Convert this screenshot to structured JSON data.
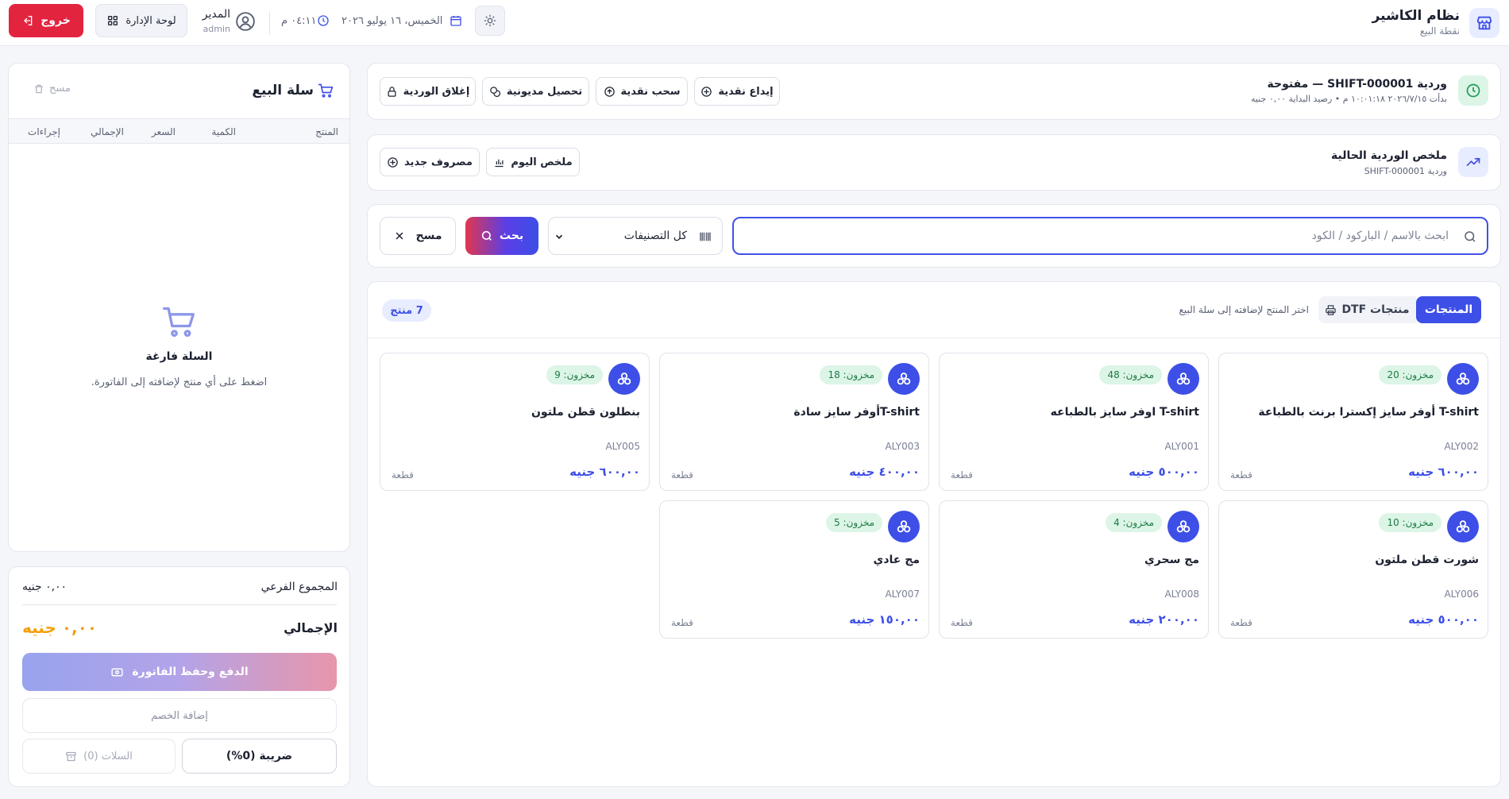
{
  "header": {
    "brand_title": "نظام الكاشير",
    "brand_subtitle": "نقطة البيع",
    "date": "الخميس، ١٦ يوليو ٢٠٢٦",
    "time": "٠٤:١١ م",
    "user_name": "المدير",
    "user_role": "admin",
    "admin_button": "لوحة الإدارة",
    "logout_button": "خروج"
  },
  "shift": {
    "title": "وردية SHIFT-000001 — مفتوحة",
    "subtitle": "بدأت ٢٠٢٦/٧/١٥ ١٠:٠١:١٨ م • رصيد البداية ٠,٠٠ جنيه",
    "actions": {
      "deposit": "إيداع نقدية",
      "withdraw": "سحب نقدية",
      "collect_debt": "تحصيل مديونية",
      "close_shift": "إغلاق الوردية"
    }
  },
  "summary": {
    "title": "ملخص الوردية الحالية",
    "subtitle": "وردية SHIFT-000001",
    "today_summary": "ملخص اليوم",
    "new_expense": "مصروف جديد"
  },
  "search": {
    "placeholder": "ابحث بالاسم / الباركود / الكود",
    "value": "",
    "category_selected": "كل التصنيفات",
    "search_button": "بحث",
    "clear_button": "مسح"
  },
  "tabs": {
    "products": "المنتجات",
    "dtf_products": "منتجات DTF",
    "hint": "اختر المنتج لإضافته إلى سلة البيع",
    "count": "7 منتج"
  },
  "products": [
    {
      "stock": "مخزون: 20",
      "name": "T-shirt أوفر سايز إكسترا برنت بالطباعة",
      "code": "ALY002",
      "price": "٦٠٠,٠٠ جنيه",
      "unit": "قطعة"
    },
    {
      "stock": "مخزون: 48",
      "name": "T-shirt اوفر سايز بالطباعه",
      "code": "ALY001",
      "price": "٥٠٠,٠٠ جنيه",
      "unit": "قطعة"
    },
    {
      "stock": "مخزون: 18",
      "name": "T-shirtأوفر سايز سادة",
      "code": "ALY003",
      "price": "٤٠٠,٠٠ جنيه",
      "unit": "قطعة"
    },
    {
      "stock": "مخزون: 9",
      "name": "بنطلون قطن ملتون",
      "code": "ALY005",
      "price": "٦٠٠,٠٠ جنيه",
      "unit": "قطعة"
    },
    {
      "stock": "مخزون: 10",
      "name": "شورت قطن ملتون",
      "code": "ALY006",
      "price": "٥٠٠,٠٠ جنيه",
      "unit": "قطعة"
    },
    {
      "stock": "مخزون: 4",
      "name": "مج سحري",
      "code": "ALY008",
      "price": "٢٠٠,٠٠ جنيه",
      "unit": "قطعة"
    },
    {
      "stock": "مخزون: 5",
      "name": "مج عادي",
      "code": "ALY007",
      "price": "١٥٠,٠٠ جنيه",
      "unit": "قطعة"
    }
  ],
  "cart": {
    "title": "سلة البيع",
    "clear": "مسح",
    "columns": {
      "product": "المنتج",
      "qty": "الكمية",
      "price": "السعر",
      "total": "الإجمالي",
      "actions": "إجراءات"
    },
    "empty_title": "السلة فارغة",
    "empty_subtitle": "اضغط على أي منتج لإضافته إلى الفاتورة."
  },
  "totals": {
    "subtotal_label": "المجموع الفرعي",
    "subtotal_value": "٠,٠٠ جنيه",
    "total_label": "الإجمالي",
    "total_value": "٠,٠٠ جنيه",
    "pay_button": "الدفع وحفظ الفاتورة",
    "discount_button": "إضافة الخصم",
    "tax_button": "ضريبة (0%)",
    "carts_button": "السلات (0)"
  },
  "colors": {
    "primary": "#3d4fe6",
    "danger": "#e3243f",
    "accent_total": "#f59e0b",
    "stock_bg": "#dcf5e6"
  }
}
